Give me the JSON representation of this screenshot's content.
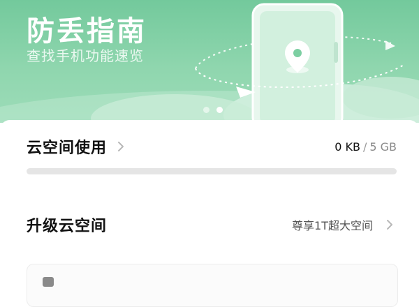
{
  "banner": {
    "title": "防丢指南",
    "subtitle": "查找手机功能速览",
    "slides_total": 2,
    "slide_active": 2,
    "colors": {
      "bg_start": "#73c99c",
      "bg_end": "#9ddcb9",
      "text": "#ffffff"
    }
  },
  "storage": {
    "title": "云空间使用",
    "used": "0 KB",
    "separator": "/",
    "total": "5 GB",
    "progress_fraction": 0,
    "progress_color": "#43b87d"
  },
  "upgrade": {
    "title": "升级云空间",
    "promo": "尊享1T超大空间"
  },
  "icons": {
    "location_pin": "location-pin-icon",
    "chevron": "chevron-right-icon"
  }
}
